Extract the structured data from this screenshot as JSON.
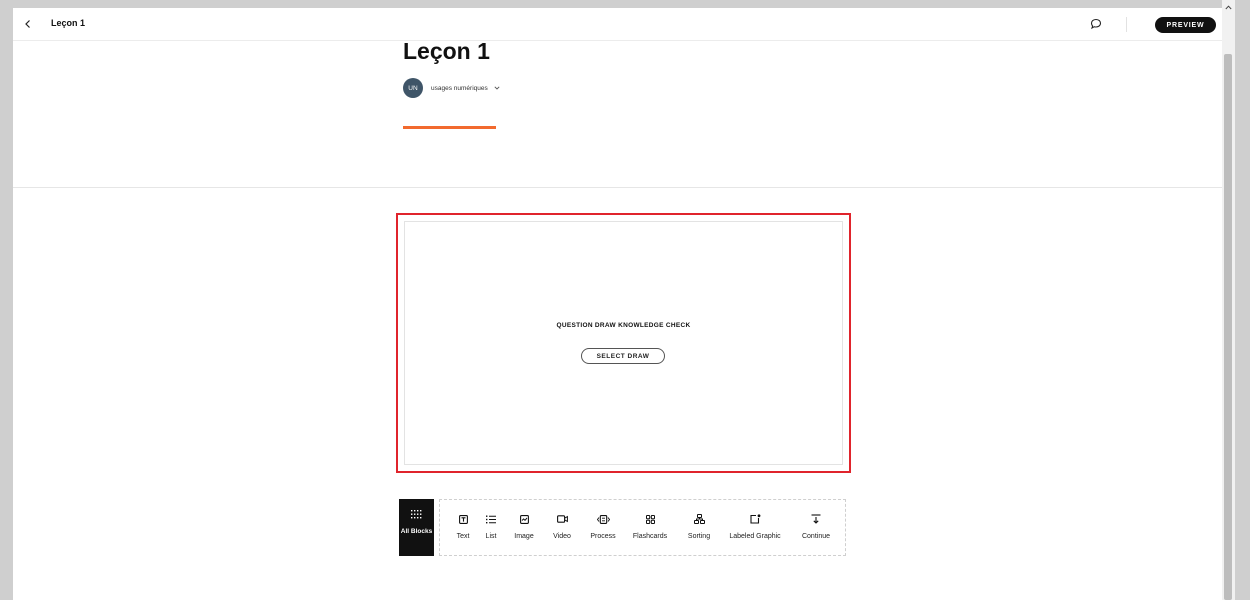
{
  "topbar": {
    "back_icon": "chevron-left-icon",
    "title": "Leçon 1",
    "comment_icon": "comment-icon",
    "preview_label": "PREVIEW"
  },
  "header": {
    "lesson_title": "Leçon 1",
    "author_initials": "UN",
    "author_name": "usages numériques",
    "accent_color": "#f26a2e",
    "avatar_color": "#3f5568"
  },
  "block": {
    "kc_label": "QUESTION DRAW KNOWLEDGE CHECK",
    "select_button": "SELECT DRAW",
    "highlight_color": "#e0242c"
  },
  "block_bar": {
    "all_blocks_label": "All Blocks",
    "items": [
      {
        "label": "Text",
        "icon": "text-icon"
      },
      {
        "label": "List",
        "icon": "list-icon"
      },
      {
        "label": "Image",
        "icon": "image-icon"
      },
      {
        "label": "Video",
        "icon": "video-icon"
      },
      {
        "label": "Process",
        "icon": "process-icon"
      },
      {
        "label": "Flashcards",
        "icon": "flashcards-icon"
      },
      {
        "label": "Sorting",
        "icon": "sorting-icon"
      },
      {
        "label": "Labeled Graphic",
        "icon": "labeled-graphic-icon"
      },
      {
        "label": "Continue",
        "icon": "continue-icon"
      }
    ]
  }
}
